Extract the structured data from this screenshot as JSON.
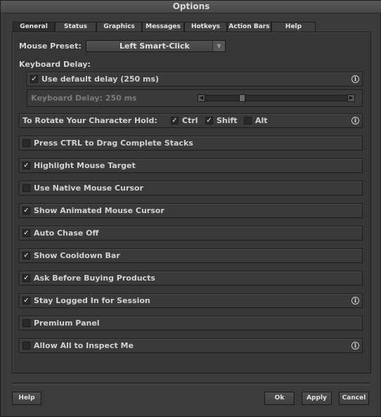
{
  "window": {
    "title": "Options"
  },
  "tabs": [
    "General",
    "Status",
    "Graphics",
    "Messages",
    "Hotkeys",
    "Action Bars",
    "Help"
  ],
  "mouse_preset": {
    "label": "Mouse Preset:",
    "value": "Left Smart-Click"
  },
  "keyboard_delay": {
    "heading": "Keyboard Delay:",
    "use_default_label": "Use default delay (250 ms)",
    "use_default_checked": true,
    "slider_label": "Keyboard Delay: 250 ms",
    "slider_value_fraction": 0.27
  },
  "rotate": {
    "label": "To Rotate Your Character Hold:",
    "ctrl": "Ctrl",
    "ctrl_checked": true,
    "shift": "Shift",
    "shift_checked": true,
    "alt": "Alt",
    "alt_checked": false
  },
  "options": [
    {
      "label": "Press CTRL to Drag Complete Stacks",
      "checked": false,
      "info": false
    },
    {
      "label": "Highlight Mouse Target",
      "checked": true,
      "info": false
    },
    {
      "label": "Use Native Mouse Cursor",
      "checked": false,
      "info": false
    },
    {
      "label": "Show Animated Mouse Cursor",
      "checked": true,
      "info": false
    },
    {
      "label": "Auto Chase Off",
      "checked": true,
      "info": false
    },
    {
      "label": "Show Cooldown Bar",
      "checked": true,
      "info": false
    },
    {
      "label": "Ask Before Buying Products",
      "checked": true,
      "info": false
    },
    {
      "label": "Stay Logged In for Session",
      "checked": true,
      "info": true
    },
    {
      "label": "Premium Panel",
      "checked": false,
      "info": false
    },
    {
      "label": "Allow All to Inspect Me",
      "checked": false,
      "info": true
    }
  ],
  "buttons": {
    "help": "Help",
    "ok": "Ok",
    "apply": "Apply",
    "cancel": "Cancel"
  },
  "glyphs": {
    "check": "✓",
    "info": "i",
    "dropdown": "▼",
    "left": "◀",
    "right": "▶"
  }
}
